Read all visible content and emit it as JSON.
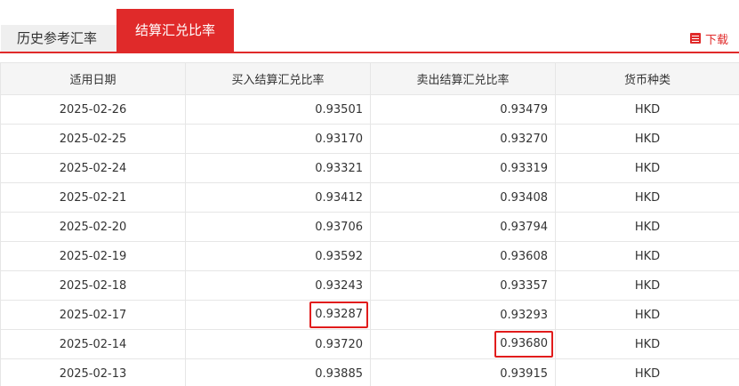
{
  "tabs": [
    {
      "label": "历史参考汇率",
      "active": false
    },
    {
      "label": "结算汇兑比率",
      "active": true
    }
  ],
  "download_label": "下载",
  "colors": {
    "accent": "#e02a2a",
    "highlight_box": "#e11c1c",
    "header_bg": "#f5f5f5"
  },
  "table": {
    "headers": [
      "适用日期",
      "买入结算汇兑比率",
      "卖出结算汇兑比率",
      "货币种类"
    ],
    "rows": [
      {
        "date": "2025-02-26",
        "buy": "0.93501",
        "sell": "0.93479",
        "currency": "HKD"
      },
      {
        "date": "2025-02-25",
        "buy": "0.93170",
        "sell": "0.93270",
        "currency": "HKD"
      },
      {
        "date": "2025-02-24",
        "buy": "0.93321",
        "sell": "0.93319",
        "currency": "HKD"
      },
      {
        "date": "2025-02-21",
        "buy": "0.93412",
        "sell": "0.93408",
        "currency": "HKD"
      },
      {
        "date": "2025-02-20",
        "buy": "0.93706",
        "sell": "0.93794",
        "currency": "HKD"
      },
      {
        "date": "2025-02-19",
        "buy": "0.93592",
        "sell": "0.93608",
        "currency": "HKD"
      },
      {
        "date": "2025-02-18",
        "buy": "0.93243",
        "sell": "0.93357",
        "currency": "HKD"
      },
      {
        "date": "2025-02-17",
        "buy": "0.93287",
        "sell": "0.93293",
        "currency": "HKD"
      },
      {
        "date": "2025-02-14",
        "buy": "0.93720",
        "sell": "0.93680",
        "currency": "HKD"
      },
      {
        "date": "2025-02-13",
        "buy": "0.93885",
        "sell": "0.93915",
        "currency": "HKD"
      }
    ]
  }
}
